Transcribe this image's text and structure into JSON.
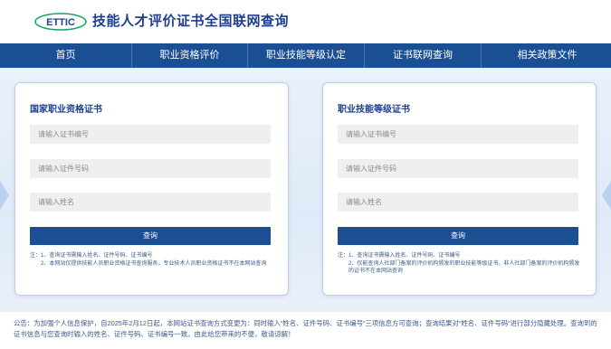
{
  "header": {
    "logo_text": "ETTIC",
    "site_title": "技能人才评价证书全国联网查询"
  },
  "nav": {
    "items": [
      {
        "label": "首页"
      },
      {
        "label": "职业资格评价"
      },
      {
        "label": "职业技能等级认定"
      },
      {
        "label": "证书联网查询"
      },
      {
        "label": "相关政策文件"
      }
    ]
  },
  "cards": [
    {
      "title": "国家职业资格证书",
      "cert_placeholder": "请输入证书编号",
      "id_placeholder": "请输入证件号码",
      "name_placeholder": "请输入姓名",
      "button_label": "查询",
      "notes_label": "注：",
      "notes": [
        "1、查询证书需输入姓名、证件号码、证书编号",
        "2、本网站仅提供技能人员职业资格证书查询服务，专业技术人员职业资格证书不在本网站查询"
      ]
    },
    {
      "title": "职业技能等级证书",
      "cert_placeholder": "请输入证书编号",
      "id_placeholder": "请输入证件号码",
      "name_placeholder": "请输入姓名",
      "button_label": "查询",
      "notes_label": "注：",
      "notes": [
        "1、查询证书需输入姓名、证件号码、证书编号",
        "2、仅能查询人社部门备案的评价机构颁发的职业技能等级证书，非人社部门备案的评价机构颁发的证书不在本网站查询"
      ]
    }
  ],
  "footer": {
    "notice": "公告：为加强个人信息保护，自2025年2月12日起，本网站证书查询方式变更为：同时输入“姓名、证件号码、证书编号”三项信息方可查询；查询结果对“姓名、证件号码”进行部分隐藏处理。查询到的证书信息与您查询时输入的姓名、证件号码、证书编号一致。由此给您带来的不便，敬请谅解！"
  },
  "colors": {
    "brand": "#1b4f94",
    "title": "#1e3f8f"
  }
}
